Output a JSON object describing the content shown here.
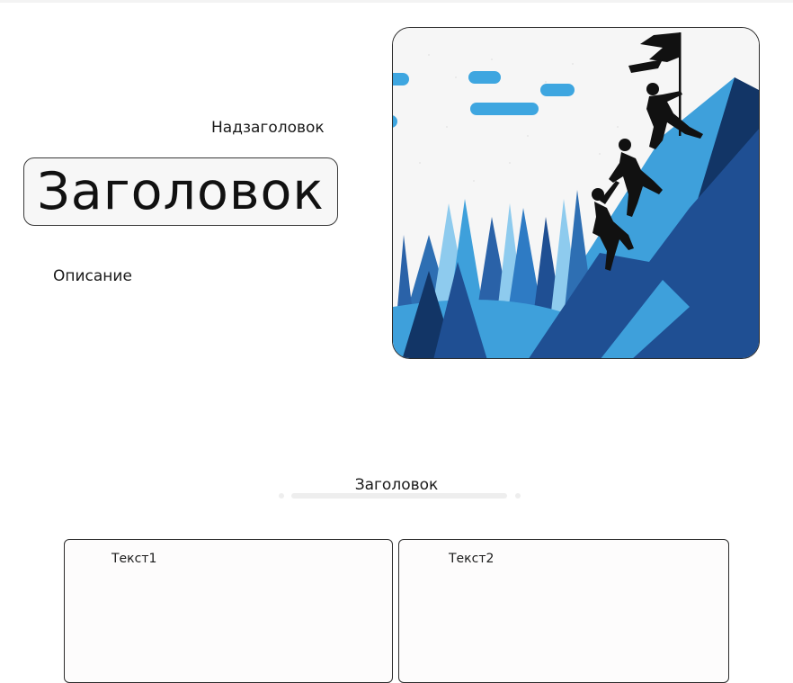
{
  "hero": {
    "overline": "Надзаголовок",
    "title": "Заголовок",
    "description": "Описание",
    "image": {
      "icon": "mountain-climbers-illustration",
      "colors": {
        "sky": "#f6f6f6",
        "cloud": "#3ea6e0",
        "mountain_dark": "#123566",
        "mountain_light": "#3ea0db",
        "silhouette": "#111111"
      }
    }
  },
  "section": {
    "heading": "Заголовок",
    "cards": [
      {
        "label": "Текст1"
      },
      {
        "label": "Текст2"
      }
    ]
  }
}
